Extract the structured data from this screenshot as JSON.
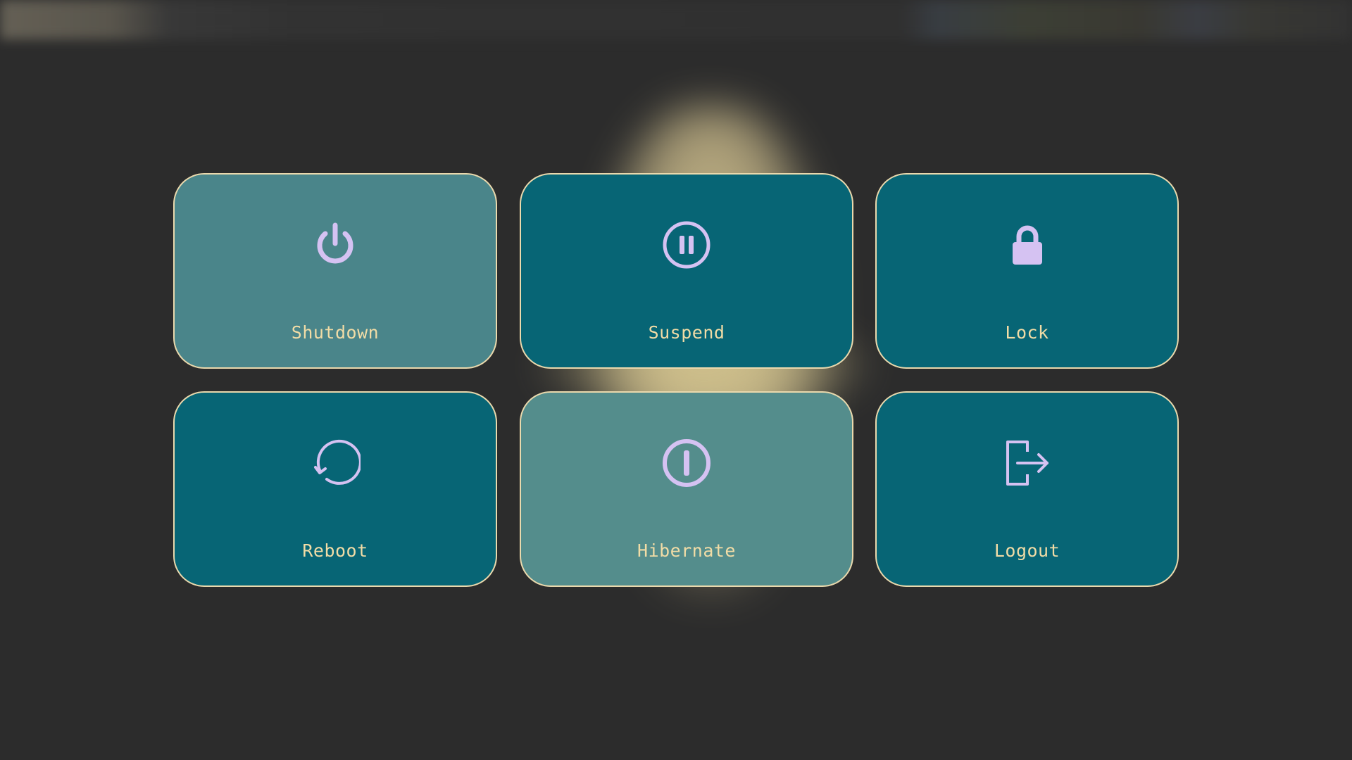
{
  "colors": {
    "background": "#2c2c2c",
    "tile": "#076575",
    "tile_hover": "#4a858a",
    "tile_focused": "#548d8c",
    "tile_border": "#ead9ad",
    "label": "#f1dca6",
    "icon": "#d5c2f2"
  },
  "actions": [
    {
      "label": "Shutdown",
      "icon": "power-icon",
      "state": "hover"
    },
    {
      "label": "Suspend",
      "icon": "pause-icon",
      "state": "normal"
    },
    {
      "label": "Lock",
      "icon": "lock-icon",
      "state": "normal"
    },
    {
      "label": "Reboot",
      "icon": "reboot-icon",
      "state": "normal"
    },
    {
      "label": "Hibernate",
      "icon": "hibernate-icon",
      "state": "focused"
    },
    {
      "label": "Logout",
      "icon": "logout-icon",
      "state": "normal"
    }
  ]
}
